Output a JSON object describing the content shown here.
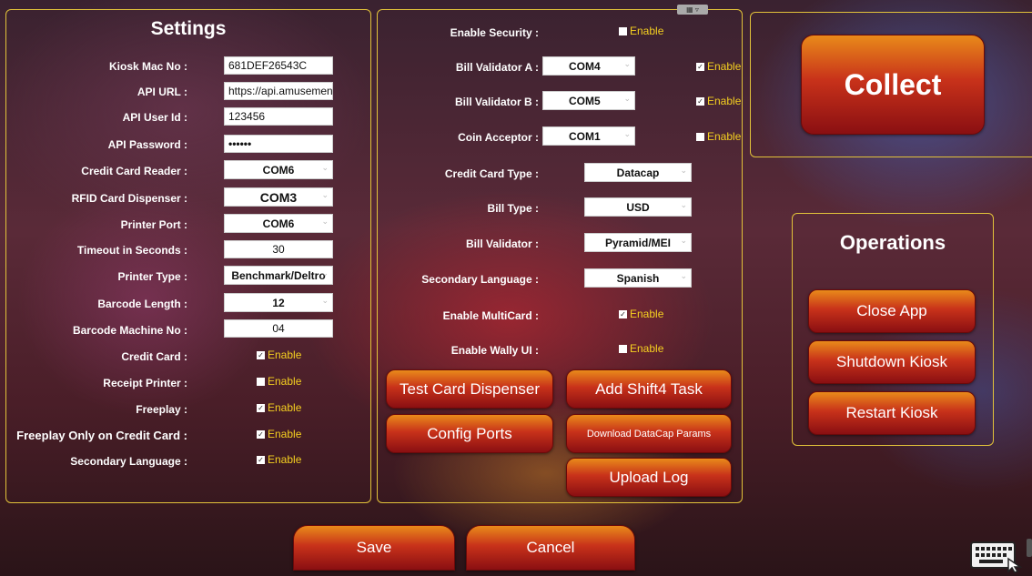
{
  "settings": {
    "title": "Settings",
    "kiosk_mac_label": "Kiosk Mac No :",
    "kiosk_mac_value": "681DEF26543C",
    "api_url_label": "API URL :",
    "api_url_value": "https://api.amusement",
    "api_user_label": "API User Id :",
    "api_user_value": "123456",
    "api_password_label": "API Password :",
    "api_password_value": "••••••",
    "cc_reader_label": "Credit Card Reader :",
    "cc_reader_value": "COM6",
    "rfid_label": "RFID Card Dispenser :",
    "rfid_value": "COM3",
    "printer_port_label": "Printer Port :",
    "printer_port_value": "COM6",
    "timeout_label": "Timeout in Seconds :",
    "timeout_value": "30",
    "printer_type_label": "Printer Type :",
    "printer_type_value": "Benchmark/Deltro",
    "barcode_length_label": "Barcode Length :",
    "barcode_length_value": "12",
    "barcode_machine_label": "Barcode Machine No :",
    "barcode_machine_value": "04",
    "credit_card_label": "Credit Card :",
    "receipt_printer_label": "Receipt Printer :",
    "freeplay_label": "Freeplay :",
    "freeplay_cc_label": "Freeplay Only on Credit Card :",
    "secondary_lang_label": "Secondary Language :",
    "enable_text": "Enable"
  },
  "hardware": {
    "enable_security_label": "Enable Security :",
    "bill_a_label": "Bill Validator A :",
    "bill_a_value": "COM4",
    "bill_b_label": "Bill Validator B :",
    "bill_b_value": "COM5",
    "coin_label": "Coin Acceptor :",
    "coin_value": "COM1",
    "cc_type_label": "Credit Card Type :",
    "cc_type_value": "Datacap",
    "bill_type_label": "Bill Type :",
    "bill_type_value": "USD",
    "bill_validator_label": "Bill Validator :",
    "bill_validator_value": "Pyramid/MEI",
    "secondary_lang_label": "Secondary Language :",
    "secondary_lang_value": "Spanish",
    "multicard_label": "Enable MultiCard :",
    "wally_label": "Enable Wally UI :",
    "enable_text": "Enable",
    "btn_test_card": "Test Card Dispenser",
    "btn_add_shift4": "Add Shift4 Task",
    "btn_config_ports": "Config Ports",
    "btn_download_datacap": "Download DataCap Params",
    "btn_upload_log": "Upload Log"
  },
  "collect": {
    "label": "Collect"
  },
  "operations": {
    "title": "Operations",
    "btn_close_app": "Close App",
    "btn_shutdown": "Shutdown Kiosk",
    "btn_restart": "Restart Kiosk"
  },
  "footer": {
    "save": "Save",
    "cancel": "Cancel"
  },
  "checkbox_states": {
    "enable_security": false,
    "bill_a": true,
    "bill_b": true,
    "coin": false,
    "multicard": true,
    "wally": false,
    "credit_card": true,
    "receipt_printer": false,
    "freeplay": true,
    "freeplay_cc": true,
    "secondary_lang": true
  },
  "colors": {
    "panel_border": "#e2c23a",
    "enable_text": "#f5d020",
    "button_top": "#e98a1a",
    "button_bottom": "#8a0f12"
  }
}
